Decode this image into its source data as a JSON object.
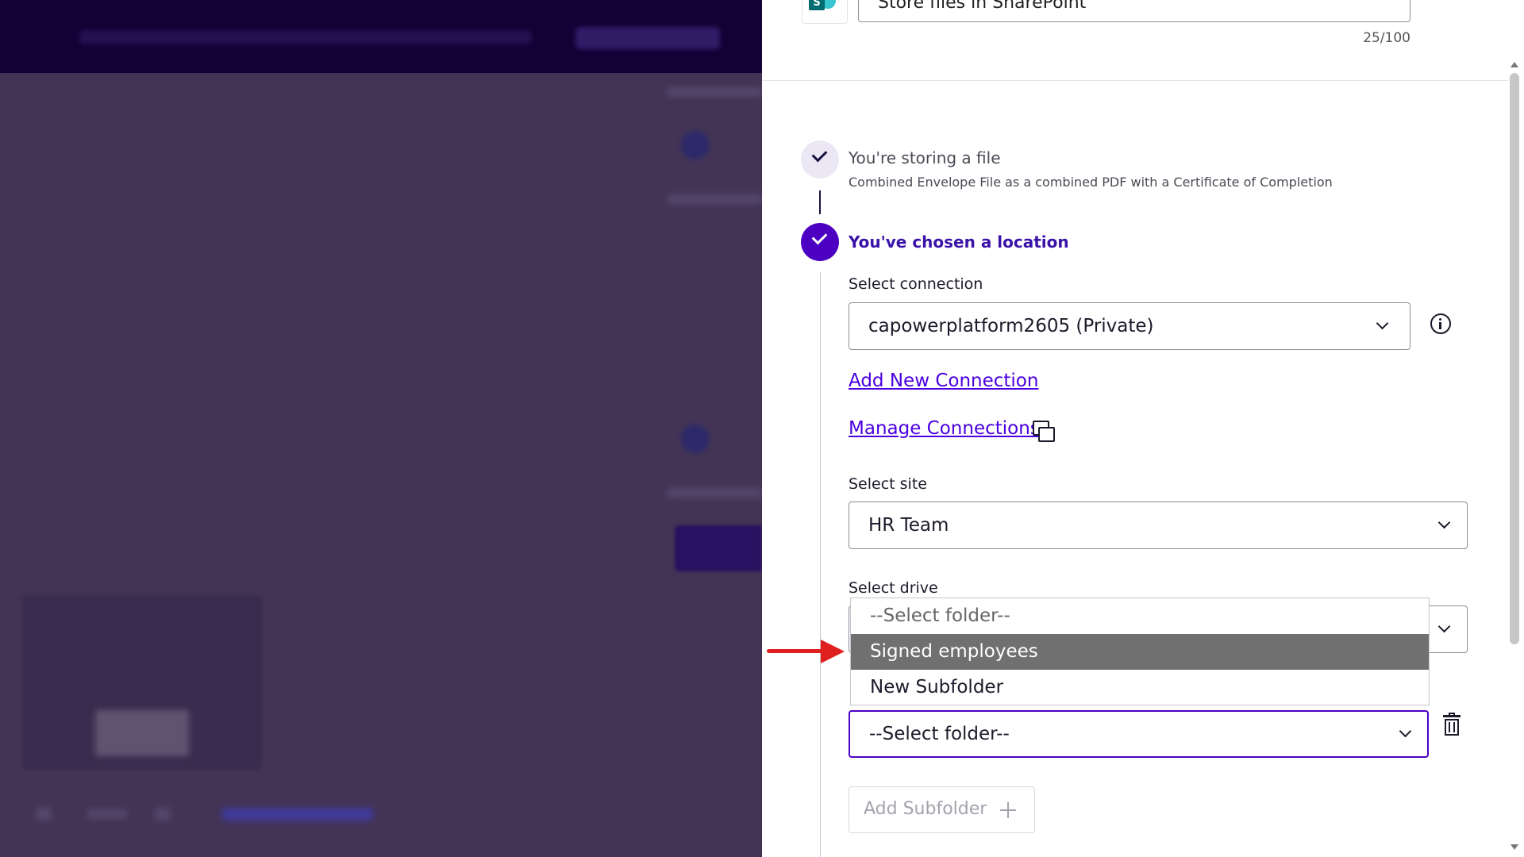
{
  "header": {
    "name_value": "Store files in SharePoint",
    "char_count": "25/100"
  },
  "steps": [
    {
      "title": "You're storing a file",
      "subtitle": "Combined Envelope File as a combined PDF with a Certificate of Completion"
    },
    {
      "title": "You've chosen a location"
    }
  ],
  "connection": {
    "label": "Select connection",
    "value": "capowerplatform2605 (Private)",
    "add_link": "Add New Connection",
    "manage_link": "Manage Connections"
  },
  "site": {
    "label": "Select site",
    "value": "HR Team"
  },
  "drive": {
    "label": "Select drive"
  },
  "folder": {
    "value": "--Select folder--",
    "options": [
      "--Select folder--",
      "Signed employees",
      "New Subfolder"
    ],
    "highlighted_option": "Signed employees"
  },
  "add_subfolder_label": "Add Subfolder",
  "colors": {
    "accent": "#4c00c2",
    "link": "#4a00e0",
    "annotation_arrow": "#e0201e",
    "overlay_bg": "#433456"
  },
  "icons": [
    "sharepoint-logo-icon",
    "check-icon",
    "info-icon",
    "chevron-down-icon",
    "external-window-icon",
    "trash-icon",
    "plus-icon"
  ]
}
